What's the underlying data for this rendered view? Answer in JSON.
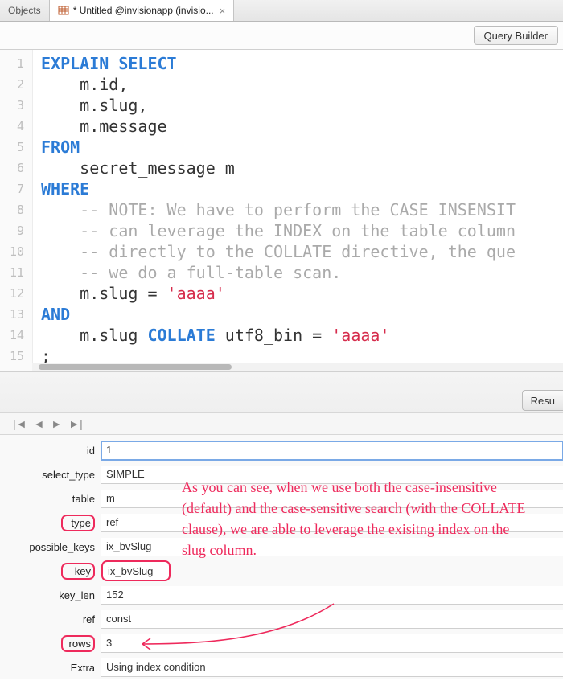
{
  "tabs": {
    "objects": "Objects",
    "active": "* Untitled @invisionapp (invisio..."
  },
  "toolbar": {
    "query_builder": "Query Builder",
    "results": "Resu"
  },
  "editor": {
    "lines": [
      {
        "n": "1"
      },
      {
        "n": "2"
      },
      {
        "n": "3"
      },
      {
        "n": "4"
      },
      {
        "n": "5"
      },
      {
        "n": "6"
      },
      {
        "n": "7"
      },
      {
        "n": "8"
      },
      {
        "n": "9"
      },
      {
        "n": "10"
      },
      {
        "n": "11"
      },
      {
        "n": "12"
      },
      {
        "n": "13"
      },
      {
        "n": "14"
      },
      {
        "n": "15"
      }
    ],
    "tok": {
      "explain": "EXPLAIN",
      "select": "SELECT",
      "m_id": "    m.id,",
      "m_slug": "    m.slug,",
      "m_msg": "    m.message",
      "from": "FROM",
      "table": "    secret_message m",
      "where": "WHERE",
      "c1": "    -- NOTE: We have to perform the CASE INSENSIT",
      "c2": "    -- can leverage the INDEX on the table column",
      "c3": "    -- directly to the COLLATE directive, the que",
      "c4": "    -- we do a full-table scan.",
      "pred1a": "    m.slug = ",
      "pred1s": "'aaaa'",
      "and": "AND",
      "pred2a": "    m.slug ",
      "collate": "COLLATE",
      "pred2b": " utf8_bin = ",
      "pred2s": "'aaaa'",
      "semi": ";"
    }
  },
  "form": {
    "id_label": "id",
    "id_val": "1",
    "select_type_label": "select_type",
    "select_type_val": "SIMPLE",
    "table_label": "table",
    "table_val": "m",
    "type_label": "type",
    "type_val": "ref",
    "possible_keys_label": "possible_keys",
    "possible_keys_val": "ix_bvSlug",
    "key_label": "key",
    "key_val": "ix_bvSlug",
    "key_len_label": "key_len",
    "key_len_val": "152",
    "ref_label": "ref",
    "ref_val": "const",
    "rows_label": "rows",
    "rows_val": "3",
    "extra_label": "Extra",
    "extra_val": "Using index condition"
  },
  "annotation": "As you can see, when we use both the case-insensitive (default) and the case-sensitive search (with the COLLATE clause), we are able to leverage the exisitng index on the slug column."
}
